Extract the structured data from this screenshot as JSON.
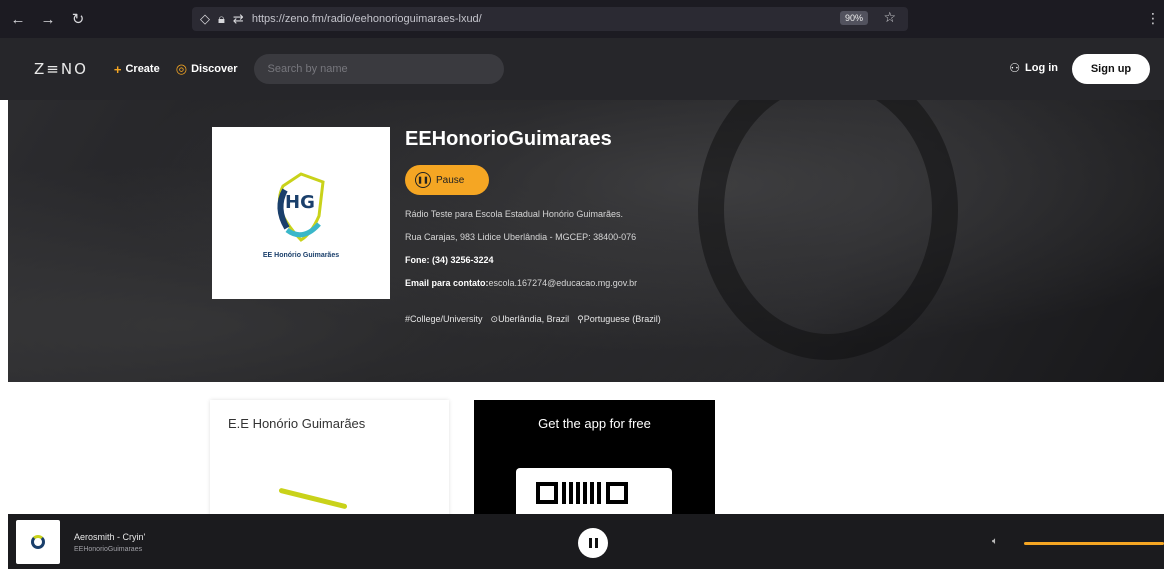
{
  "browser": {
    "url": "https://zeno.fm/radio/eehonorioguimaraes-lxud/",
    "zoom": "90%"
  },
  "header": {
    "logo": "Z≡NO",
    "create_label": "Create",
    "discover_label": "Discover",
    "search_placeholder": "Search by name",
    "login_label": "Log in",
    "signup_label": "Sign up"
  },
  "station": {
    "name": "EEHonorioGuimaraes",
    "logo_initials": "HG",
    "logo_caption": "EE Honório Guimarães",
    "pause_label": "Pause",
    "description": "Rádio Teste para Escola Estadual Honório Guimarães.",
    "address": "Rua Carajas, 983 Lidice Uberlândia - MGCEP: 38400-076",
    "phone_label": "Fone: (34) 3256-3224",
    "email_label": "Email para contato:",
    "email_value": "escola.167274@educacao.mg.gov.br",
    "tags": [
      "#College/University",
      "⊙Uberlândia, Brazil",
      "⚲Portuguese (Brazil)"
    ]
  },
  "content": {
    "card_title": "E.E Honório Guimarães",
    "app_title": "Get the app for free"
  },
  "player": {
    "track_title": "Aerosmith - Cryin'",
    "track_artist": "EEHonorioGuimaraes",
    "progress": 1.0
  },
  "colors": {
    "accent": "#f5a623",
    "header_bg": "#26262a",
    "browser_bg": "#1c1b22"
  }
}
